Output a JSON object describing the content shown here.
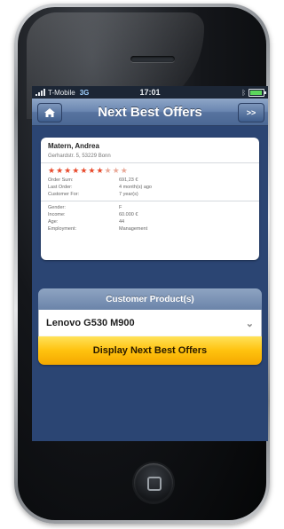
{
  "status_bar": {
    "carrier": "T-Mobile",
    "network": "3G",
    "time": "17:01",
    "battery_level": 0.9
  },
  "nav": {
    "title": "Next Best Offers",
    "next_label": ">>",
    "home_icon": "home-icon"
  },
  "customer": {
    "name": "Matern, Andrea",
    "address": "Gerhardstr. 5, 53229 Bonn",
    "rating": 7,
    "rating_max": 10,
    "order_fields": [
      {
        "label": "Order Sum:",
        "value": "691,23 €"
      },
      {
        "label": "Last Order:",
        "value": "4 month(s) ago"
      },
      {
        "label": "Customer For:",
        "value": "7 year(s)"
      }
    ],
    "profile_fields": [
      {
        "label": "Gender:",
        "value": "F"
      },
      {
        "label": "Income:",
        "value": "60.000 €"
      },
      {
        "label": "Age:",
        "value": "44"
      },
      {
        "label": "Employment:",
        "value": "Management"
      }
    ]
  },
  "products": {
    "header": "Customer Product(s)",
    "selected": "Lenovo G530 M900"
  },
  "action": {
    "label": "Display Next Best Offers"
  },
  "colors": {
    "screen_bg": "#2b4573",
    "star": "#e84a2c",
    "button": "#ffc20e"
  }
}
